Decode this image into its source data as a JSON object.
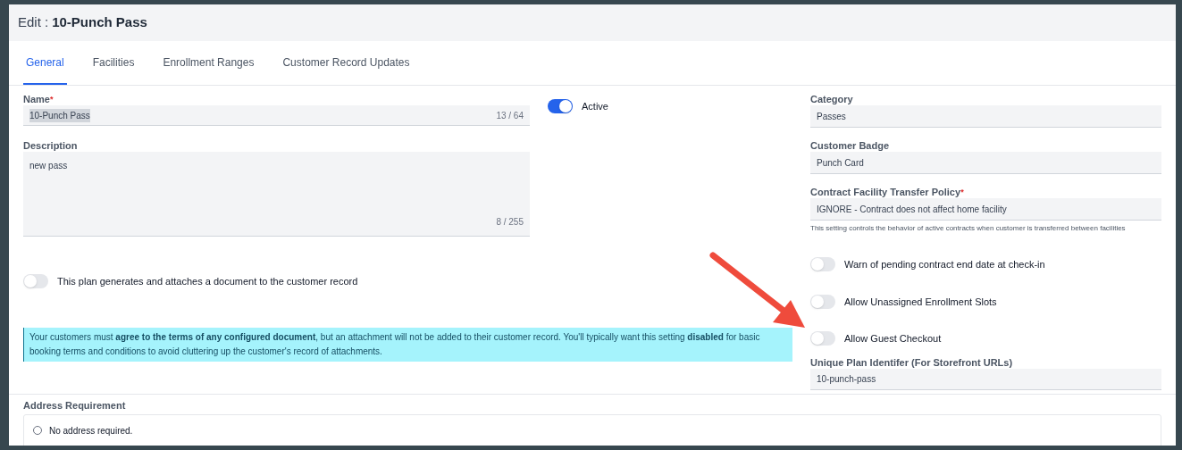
{
  "header": {
    "prefix": "Edit :",
    "title": "10-Punch Pass"
  },
  "tabs": [
    {
      "label": "General",
      "selected": true
    },
    {
      "label": "Facilities",
      "selected": false
    },
    {
      "label": "Enrollment Ranges",
      "selected": false
    },
    {
      "label": "Customer Record Updates",
      "selected": false
    }
  ],
  "name_field": {
    "label": "Name",
    "required_mark": "*",
    "value": "10-Punch Pass",
    "counter": "13 / 64"
  },
  "description_field": {
    "label": "Description",
    "value": "new pass",
    "counter": "8 / 255"
  },
  "active_toggle": {
    "label": "Active",
    "on": true
  },
  "document_toggle": {
    "label": "This plan generates and attaches a document to the customer record",
    "on": false
  },
  "info_note": "Your customers must **agree to the terms of any configured document**, but an attachment will not be added to their customer record. You'll typically want this setting **disabled** for basic booking terms and conditions to avoid cluttering up the customer's record of attachments.",
  "right_fields": [
    {
      "label": "Category",
      "value": "Passes"
    },
    {
      "label": "Customer Badge",
      "value": "Punch Card"
    },
    {
      "label": "Contract Facility Transfer Policy",
      "required_mark": "*",
      "value": "IGNORE - Contract does not affect home facility",
      "hint": "This setting controls the behavior of active contracts when customer is transferred between facilities"
    }
  ],
  "right_toggles": [
    {
      "label": "Warn of pending contract end date at check-in",
      "on": false
    },
    {
      "label": "Allow Unassigned Enrollment Slots",
      "on": false
    },
    {
      "label": "Allow Guest Checkout",
      "on": false
    }
  ],
  "plan_identifier": {
    "label": "Unique Plan Identifer (For Storefront URLs)",
    "value": "10-punch-pass"
  },
  "address_requirement": {
    "label": "Address Requirement",
    "options": [
      {
        "label": "No address required.",
        "selected": false
      }
    ]
  }
}
